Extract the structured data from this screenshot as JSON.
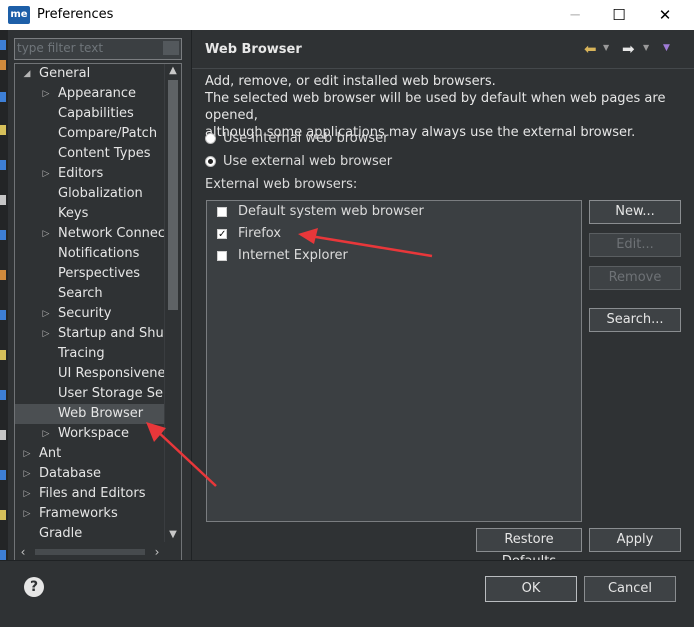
{
  "window": {
    "title": "Preferences",
    "app_icon_text": "me",
    "controls": {
      "minimize": "─",
      "maximize": "☐",
      "close": "✕"
    }
  },
  "filter": {
    "placeholder": "type filter text",
    "value": ""
  },
  "tree": [
    {
      "label": "General",
      "level": 0,
      "expander": "expanded"
    },
    {
      "label": "Appearance",
      "level": 1,
      "expander": "collapsed"
    },
    {
      "label": "Capabilities",
      "level": 1,
      "expander": "none"
    },
    {
      "label": "Compare/Patch",
      "level": 1,
      "expander": "none"
    },
    {
      "label": "Content Types",
      "level": 1,
      "expander": "none"
    },
    {
      "label": "Editors",
      "level": 1,
      "expander": "collapsed"
    },
    {
      "label": "Globalization",
      "level": 1,
      "expander": "none"
    },
    {
      "label": "Keys",
      "level": 1,
      "expander": "none"
    },
    {
      "label": "Network Connecti",
      "level": 1,
      "expander": "collapsed"
    },
    {
      "label": "Notifications",
      "level": 1,
      "expander": "none"
    },
    {
      "label": "Perspectives",
      "level": 1,
      "expander": "none"
    },
    {
      "label": "Search",
      "level": 1,
      "expander": "none"
    },
    {
      "label": "Security",
      "level": 1,
      "expander": "collapsed"
    },
    {
      "label": "Startup and Shutd",
      "level": 1,
      "expander": "collapsed"
    },
    {
      "label": "Tracing",
      "level": 1,
      "expander": "none"
    },
    {
      "label": "UI Responsiveness",
      "level": 1,
      "expander": "none"
    },
    {
      "label": "User Storage Serv",
      "level": 1,
      "expander": "none"
    },
    {
      "label": "Web Browser",
      "level": 1,
      "expander": "none",
      "selected": true
    },
    {
      "label": "Workspace",
      "level": 1,
      "expander": "collapsed"
    },
    {
      "label": "Ant",
      "level": 0,
      "expander": "collapsed"
    },
    {
      "label": "Database",
      "level": 0,
      "expander": "collapsed"
    },
    {
      "label": "Files and Editors",
      "level": 0,
      "expander": "collapsed"
    },
    {
      "label": "Frameworks",
      "level": 0,
      "expander": "collapsed"
    },
    {
      "label": "Gradle",
      "level": 0,
      "expander": "none"
    }
  ],
  "page": {
    "title": "Web Browser",
    "description": [
      "Add, remove, or edit installed web browsers.",
      "The selected web browser will be used by default when web pages are opened,",
      "although some applications may always use the external browser."
    ],
    "radio_internal": "Use internal web browser",
    "radio_external": "Use external web browser",
    "selected_radio": "external",
    "external_label": "External web browsers:",
    "browsers": [
      {
        "label": "Default system web browser",
        "checked": false
      },
      {
        "label": "Firefox",
        "checked": true
      },
      {
        "label": "Internet Explorer",
        "checked": false
      }
    ],
    "buttons": {
      "new": "New...",
      "edit": "Edit...",
      "remove": "Remove",
      "search": "Search..."
    },
    "restore_defaults": "Restore Defaults",
    "apply": "Apply"
  },
  "footer": {
    "help": "?",
    "ok": "OK",
    "cancel": "Cancel"
  },
  "colors": {
    "annotation_arrow": "#e8373a",
    "background": "#2f3234",
    "selection": "#4b4f52"
  }
}
